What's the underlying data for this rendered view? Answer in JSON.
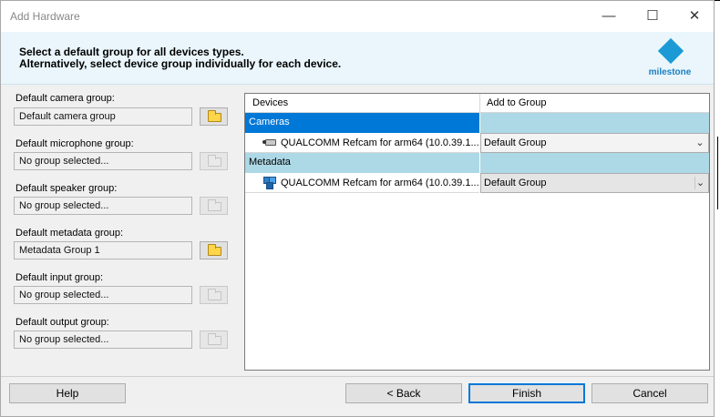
{
  "window": {
    "title": "Add Hardware",
    "controls": {
      "minimize": "—",
      "maximize": "☐",
      "close": "✕"
    }
  },
  "header": {
    "line1": "Select a default group for all devices types.",
    "line2": "Alternatively, select device group individually for each device.",
    "logo_text": "milestone"
  },
  "groups": [
    {
      "label": "Default camera group:",
      "value": "Default camera group",
      "button_enabled": true
    },
    {
      "label": "Default microphone group:",
      "value": "No group selected...",
      "button_enabled": false
    },
    {
      "label": "Default speaker group:",
      "value": "No group selected...",
      "button_enabled": false
    },
    {
      "label": "Default metadata group:",
      "value": "Metadata Group 1",
      "button_enabled": true
    },
    {
      "label": "Default input group:",
      "value": "No group selected...",
      "button_enabled": false
    },
    {
      "label": "Default output group:",
      "value": "No group selected...",
      "button_enabled": false
    }
  ],
  "grid": {
    "columns": [
      "Devices",
      "Add to Group"
    ],
    "categories": [
      {
        "name": "Cameras",
        "device": "QUALCOMM Refcam for arm64 (10.0.39.1...",
        "group": "Default Group",
        "icon": "camera-icon"
      },
      {
        "name": "Metadata",
        "device": "QUALCOMM Refcam for arm64 (10.0.39.1...",
        "group": "Default Group",
        "icon": "metadata-icon"
      }
    ]
  },
  "buttons": {
    "help": "Help",
    "back": "< Back",
    "finish": "Finish",
    "cancel": "Cancel"
  },
  "colors": {
    "accent": "#0078d7",
    "category_bg": "#add8e6",
    "header_bg": "#eaf6fb",
    "logo": "#1b9ad6"
  }
}
